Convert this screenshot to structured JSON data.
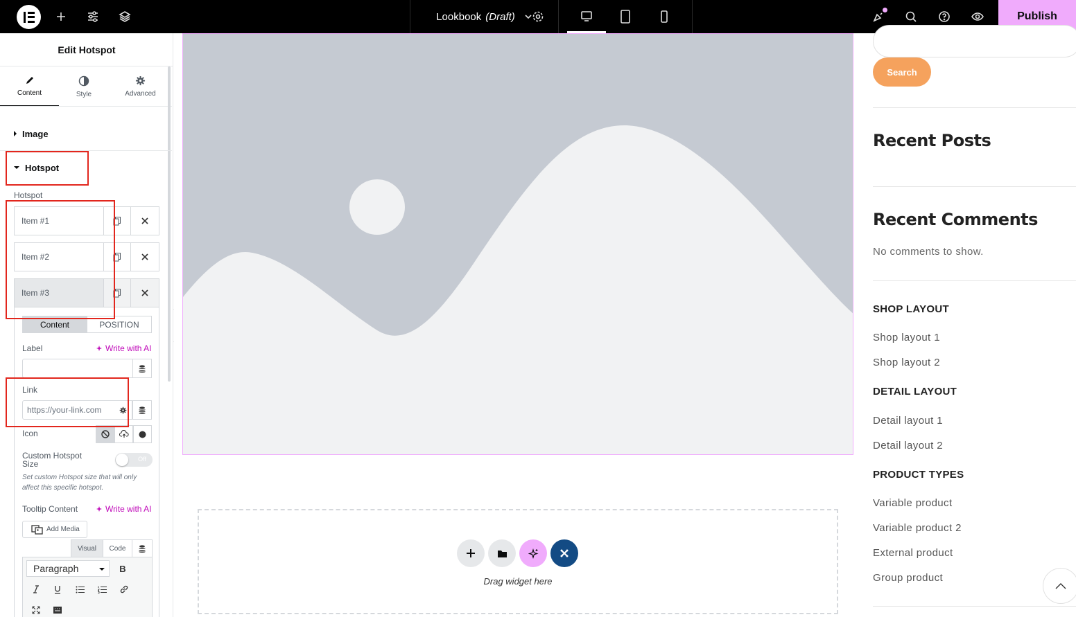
{
  "topbar": {
    "doc_name": "Lookbook",
    "doc_status": "(Draft)",
    "publish_label": "Publish",
    "icons": [
      "elementor-logo-icon",
      "add-icon",
      "sliders-icon",
      "layers-icon",
      "chevron-down-icon",
      "gear-icon",
      "desktop-icon",
      "tablet-icon",
      "mobile-icon",
      "whats-new-icon",
      "search-icon",
      "help-icon",
      "eye-icon"
    ]
  },
  "panel": {
    "title": "Edit Hotspot",
    "tabs": [
      {
        "label": "Content",
        "icon": "pencil-icon"
      },
      {
        "label": "Style",
        "icon": "half-circle-icon"
      },
      {
        "label": "Advanced",
        "icon": "gear-icon"
      }
    ],
    "sections": {
      "image": "Image",
      "hotspot": "Hotspot"
    },
    "hotspot_label": "Hotspot",
    "items": [
      {
        "label": "Item #1"
      },
      {
        "label": "Item #2"
      },
      {
        "label": "Item #3"
      }
    ],
    "item_tabs": {
      "content": "Content",
      "position": "POSITION"
    },
    "label_field": {
      "label": "Label",
      "value": "",
      "ai": "Write with AI"
    },
    "link_field": {
      "label": "Link",
      "placeholder": "https://your-link.com"
    },
    "icon_field": {
      "label": "Icon",
      "choices": [
        "none-icon",
        "upload-icon",
        "circle-icon"
      ]
    },
    "custom_size": {
      "label": "Custom Hotspot Size",
      "toggle": "Off",
      "help": "Set custom Hotspot size that will only affect this specific hotspot."
    },
    "tooltip": {
      "label": "Tooltip Content",
      "ai": "Write with AI",
      "add_media": "Add Media",
      "tab_visual": "Visual",
      "tab_code": "Code",
      "format": "Paragraph",
      "bold": "B"
    }
  },
  "canvas": {
    "drop_text": "Drag widget here"
  },
  "sidebar": {
    "search_button": "Search",
    "recent_posts": "Recent Posts",
    "recent_comments": "Recent Comments",
    "no_comments": "No comments to show.",
    "groups": [
      {
        "title": "SHOP LAYOUT",
        "links": [
          "Shop layout 1",
          "Shop layout 2"
        ]
      },
      {
        "title": "DETAIL LAYOUT",
        "links": [
          "Detail layout 1",
          "Detail layout 2"
        ]
      },
      {
        "title": "PRODUCT TYPES",
        "links": [
          "Variable product",
          "Variable product 2",
          "External product",
          "Group product"
        ]
      }
    ]
  },
  "colors": {
    "accent_pink": "#f0abfc",
    "ai_magenta": "#c00bb9",
    "search_orange": "#f5a25d",
    "highlight_red": "#e2261d",
    "placeholder_gray": "#c5cad2"
  }
}
